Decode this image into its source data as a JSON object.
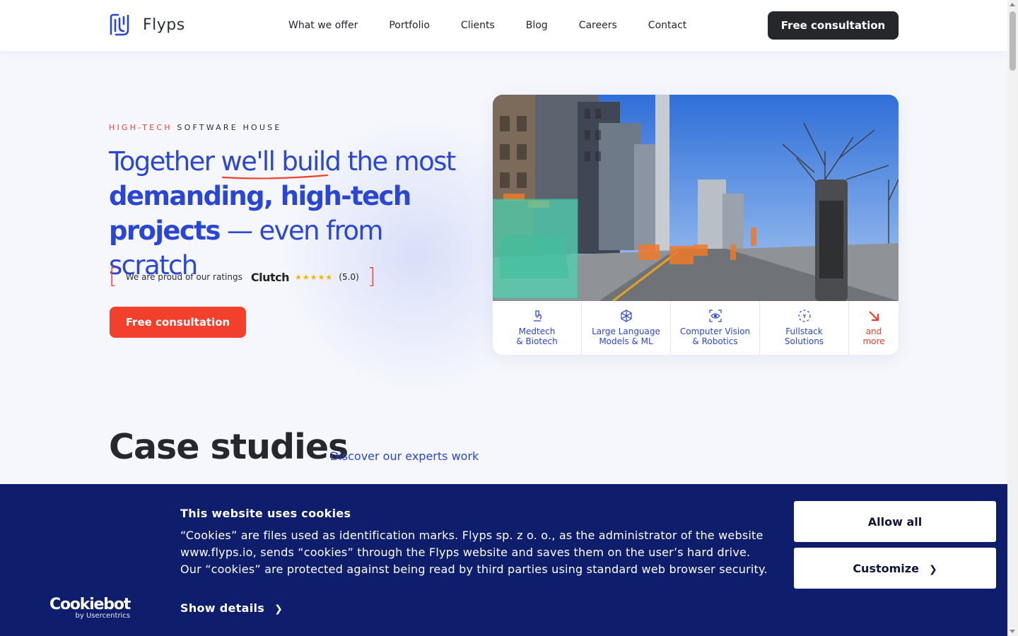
{
  "header": {
    "logo_text": "Flyps",
    "nav": [
      "What we offer",
      "Portfolio",
      "Clients",
      "Blog",
      "Careers",
      "Contact"
    ],
    "cta_label": "Free consultation"
  },
  "hero": {
    "eyebrow_accent": "HIGH-TECH",
    "eyebrow_rest": "SOFTWARE HOUSE",
    "headline": {
      "part1": "Together ",
      "underlined": "we'll build",
      "part2": " the most",
      "bold_line1": "demanding, high-tech",
      "bold_line2": "projects",
      "tail": " — even from scratch"
    },
    "ratings": {
      "intro": "We are proud of our ratings",
      "brand": "Clutch",
      "stars": "★★★★★",
      "score": "(5.0)"
    },
    "cta_label": "Free consultation"
  },
  "services": [
    {
      "label": "Medtech\n& Biotech",
      "icon": "microscope-icon"
    },
    {
      "label": "Large Language\nModels & ML",
      "icon": "cube-network-icon"
    },
    {
      "label": "Computer Vision\n& Robotics",
      "icon": "eye-scan-icon"
    },
    {
      "label": "Fullstack\nSolutions",
      "icon": "code-frame-icon"
    },
    {
      "label": "and\nmore",
      "icon": "arrow-down-right-icon"
    }
  ],
  "case_studies": {
    "title": "Case studies",
    "link": "Discover our experts work"
  },
  "cookie_banner": {
    "title": "This website uses cookies",
    "body": "“Cookies” are files used as identification marks. Flyps sp. z o. o., as the administrator of the website www.flyps.io, sends “cookies” through the Flyps website and saves them on the user’s hard drive. Our “cookies” are protected against being read by third parties using standard web browser security.",
    "show_details": "Show details",
    "allow_all": "Allow all",
    "customize": "Customize",
    "brand_main": "Cookiebot",
    "brand_sub": "by Usercentrics"
  },
  "colors": {
    "accent_blue": "#2a46d6",
    "accent_red": "#f2402c",
    "banner_bg": "#0e1e6c",
    "dark_button": "#26272b"
  }
}
